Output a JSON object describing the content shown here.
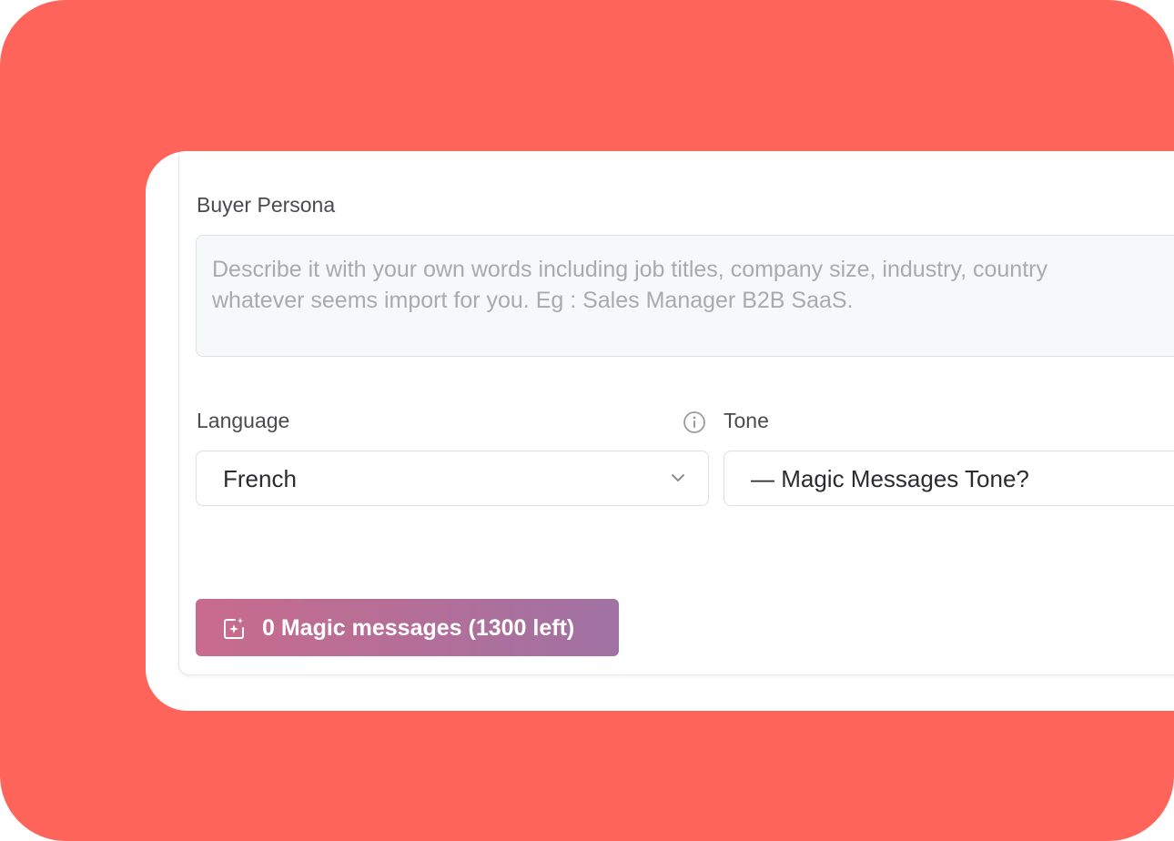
{
  "form": {
    "buyer_persona": {
      "label": "Buyer Persona",
      "placeholder_line1": "Describe it with your own words including job titles, company size, industry, country",
      "placeholder_line2": "whatever seems import for you. Eg : Sales Manager B2B SaaS."
    },
    "language": {
      "label": "Language",
      "value": "French"
    },
    "tone": {
      "label": "Tone",
      "value": "— Magic Messages Tone?"
    },
    "submit": {
      "label": "0 Magic messages (1300 left)"
    }
  },
  "colors": {
    "background": "#ff645a",
    "button_gradient_start": "#c96b8c",
    "button_gradient_end": "#a072a3"
  },
  "icons": {
    "info": "info-icon",
    "chevron": "chevron-down-icon",
    "button": "magic-sparkle-icon"
  }
}
